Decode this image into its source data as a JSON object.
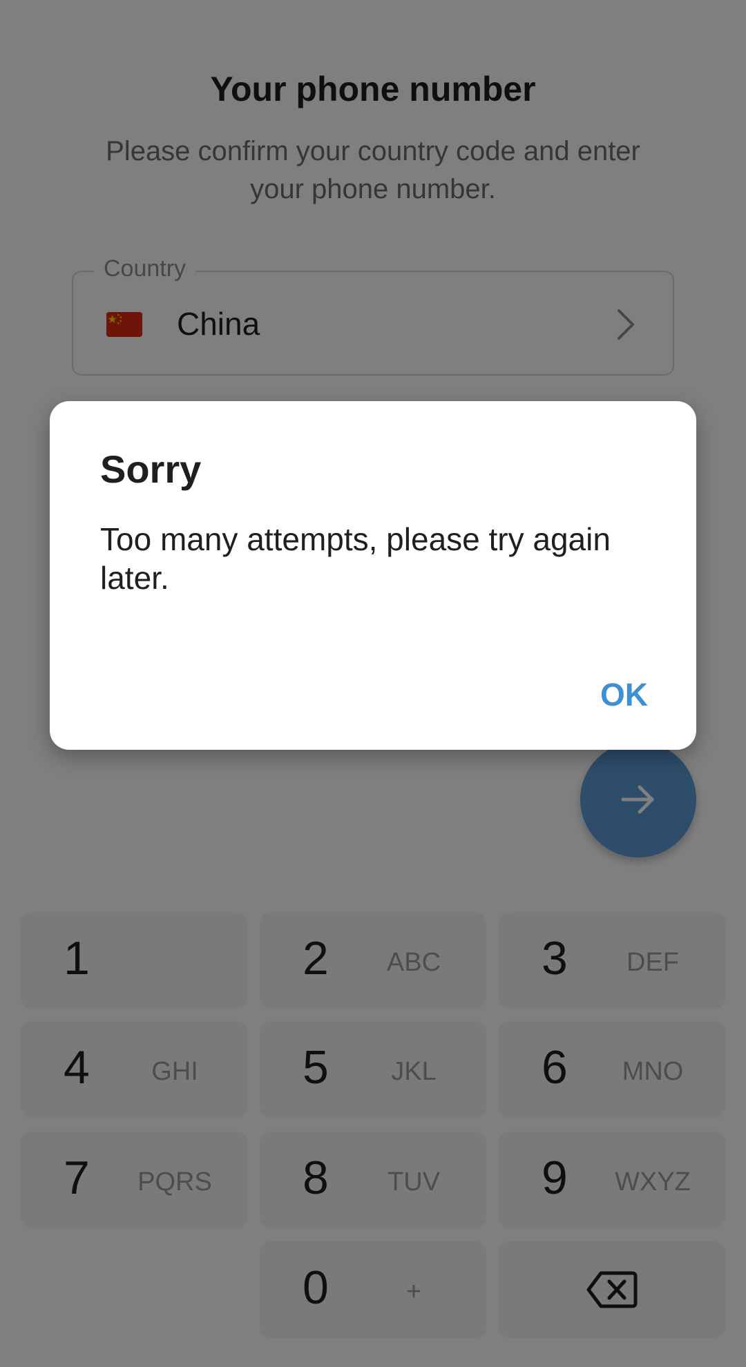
{
  "header": {
    "title": "Your phone number",
    "subtitle": "Please confirm your country code and enter your phone number."
  },
  "country_field": {
    "legend": "Country",
    "value": "China",
    "flag_icon": "china-flag-icon"
  },
  "fab": {
    "icon": "arrow-right-icon",
    "color": "#5b9ad4"
  },
  "keypad": {
    "keys": [
      {
        "digit": "1",
        "letters": ""
      },
      {
        "digit": "2",
        "letters": "ABC"
      },
      {
        "digit": "3",
        "letters": "DEF"
      },
      {
        "digit": "4",
        "letters": "GHI"
      },
      {
        "digit": "5",
        "letters": "JKL"
      },
      {
        "digit": "6",
        "letters": "MNO"
      },
      {
        "digit": "7",
        "letters": "PQRS"
      },
      {
        "digit": "8",
        "letters": "TUV"
      },
      {
        "digit": "9",
        "letters": "WXYZ"
      },
      {
        "digit": "0",
        "letters": "+"
      }
    ],
    "backspace_icon": "backspace-icon"
  },
  "dialog": {
    "title": "Sorry",
    "message": "Too many attempts, please try again later.",
    "ok_label": "OK",
    "accent_color": "#3f8fd3"
  }
}
